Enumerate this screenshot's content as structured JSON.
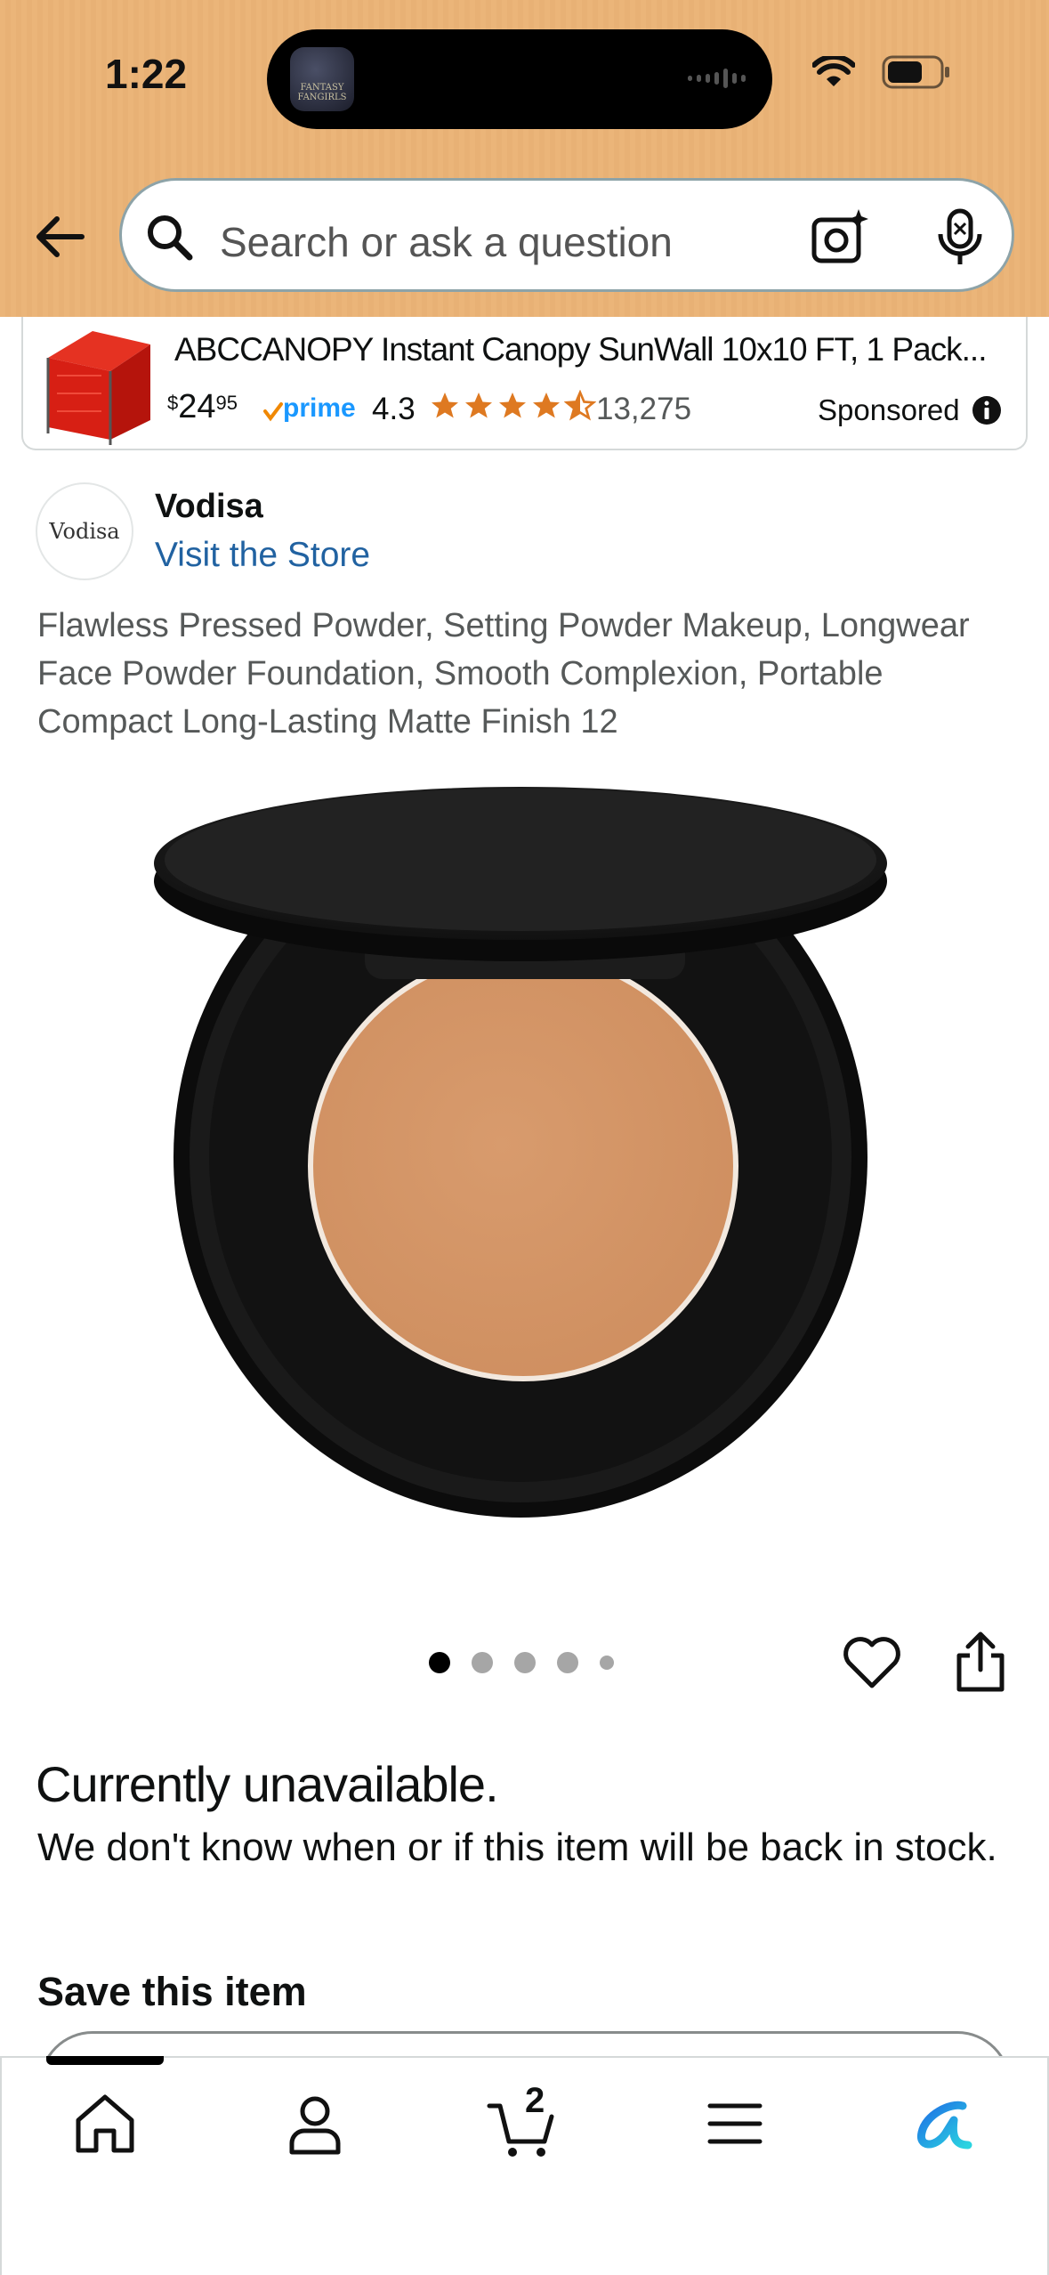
{
  "status_bar": {
    "time": "1:22",
    "island_app_label": "FANTASY FANGIRLS"
  },
  "search": {
    "placeholder": "Search or ask a question"
  },
  "sponsored_ad": {
    "title": "ABCCANOPY Instant Canopy SunWall 10x10 FT, 1 Pack...",
    "price_currency": "$",
    "price_whole": "24",
    "price_fraction": "95",
    "prime_label": "prime",
    "rating": "4.3",
    "rating_value": 4.3,
    "review_count": "13,275",
    "sponsored_label": "Sponsored"
  },
  "brand": {
    "logo_text": "Vodisa",
    "name": "Vodisa",
    "store_link": "Visit the Store"
  },
  "product": {
    "title": "Flawless Pressed Powder, Setting Powder Makeup, Longwear Face Powder Foundation, Smooth Complexion, Portable Compact Long-Lasting Matte Finish 12",
    "image_count": 5,
    "active_image": 1
  },
  "availability": {
    "status": "Currently unavailable.",
    "message": "We don't know when or if this item will be back in stock."
  },
  "save_section": {
    "title": "Save this item"
  },
  "bottom_nav": {
    "items": [
      "home-icon",
      "account-icon",
      "cart-icon",
      "menu-icon",
      "rufus-icon"
    ],
    "cart_count": "2"
  },
  "colors": {
    "header_bg": "#ebb579",
    "link": "#2162a1",
    "star": "#de7921",
    "prime": "#1a98ff",
    "powder": "#d49566"
  }
}
